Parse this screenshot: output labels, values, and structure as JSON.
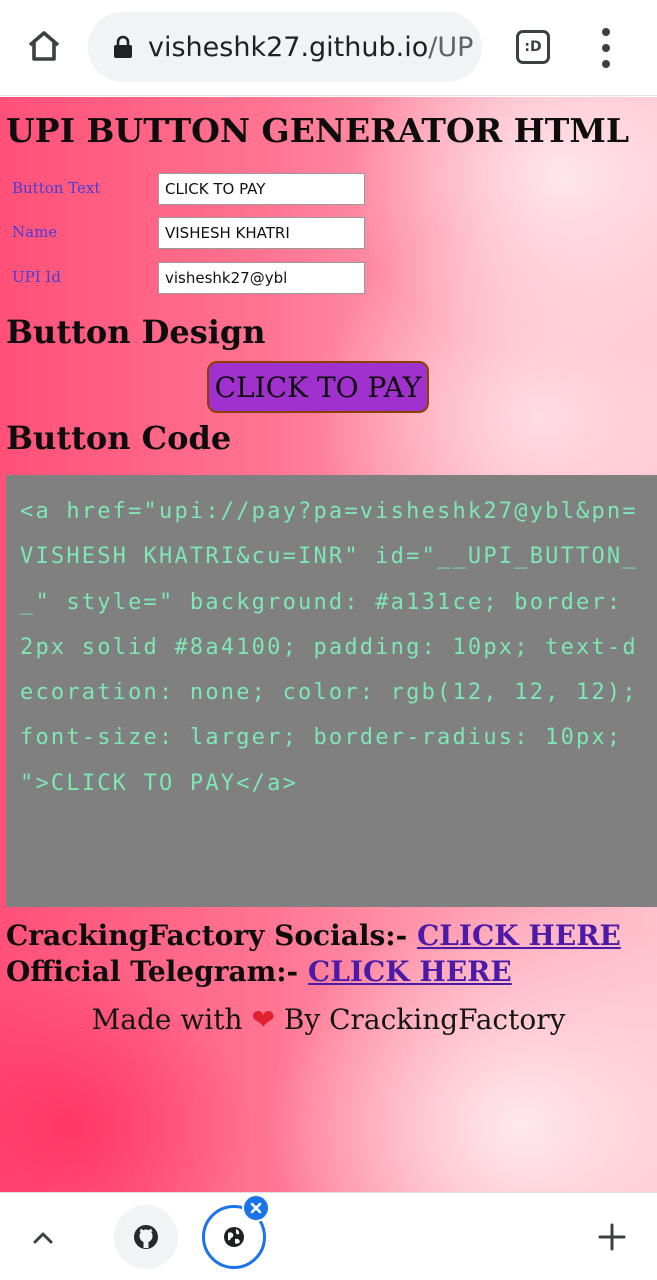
{
  "browser": {
    "url_host": "vishesh​k27.github.io",
    "url_path": "/UP",
    "tab_switcher_label": ":D"
  },
  "page": {
    "title": "UPI BUTTON GENERATOR HTML",
    "form": {
      "fields": [
        {
          "label": "Button Text",
          "value": "CLICK TO PAY"
        },
        {
          "label": "Name",
          "value": "VISHESH KHATRI"
        },
        {
          "label": "UPI Id",
          "value": "visheshk27@ybl"
        }
      ]
    },
    "design_heading": "Button Design",
    "preview_button": {
      "label": "CLICK TO PAY",
      "background": "#a131ce",
      "border": "#8a4100"
    },
    "code_heading": "Button Code",
    "code": "<a href=\"upi://pay?pa=visheshk27@ybl&pn=VISHESH KHATRI&cu=INR\" id=\"__UPI_BUTTON__\" style=\" background: #a131ce; border: 2px solid #8a4100; padding: 10px; text-decoration: none; color: rgb(12, 12, 12); font-size: larger; border-radius: 10px; \">CLICK TO PAY</a>",
    "socials": {
      "label": "CrackingFactory Socials:-",
      "link": "CLICK HERE"
    },
    "telegram": {
      "label": "Official Telegram:-",
      "link": "CLICK HERE"
    },
    "footer": {
      "prefix": "Made with",
      "heart": "❤",
      "suffix": "By CrackingFactory"
    }
  },
  "colors": {
    "code_text": "#7ee8b5",
    "code_bg": "#808080",
    "link": "#4b1aa8",
    "label": "#4a3bd6",
    "accent": "#1a73e8"
  },
  "icons": {
    "home": "home-icon",
    "lock": "lock-icon",
    "menu": "more-vert-icon",
    "up": "chevron-up-icon",
    "github": "github-icon",
    "globe": "globe-icon",
    "close": "close-icon",
    "add": "plus-icon"
  }
}
